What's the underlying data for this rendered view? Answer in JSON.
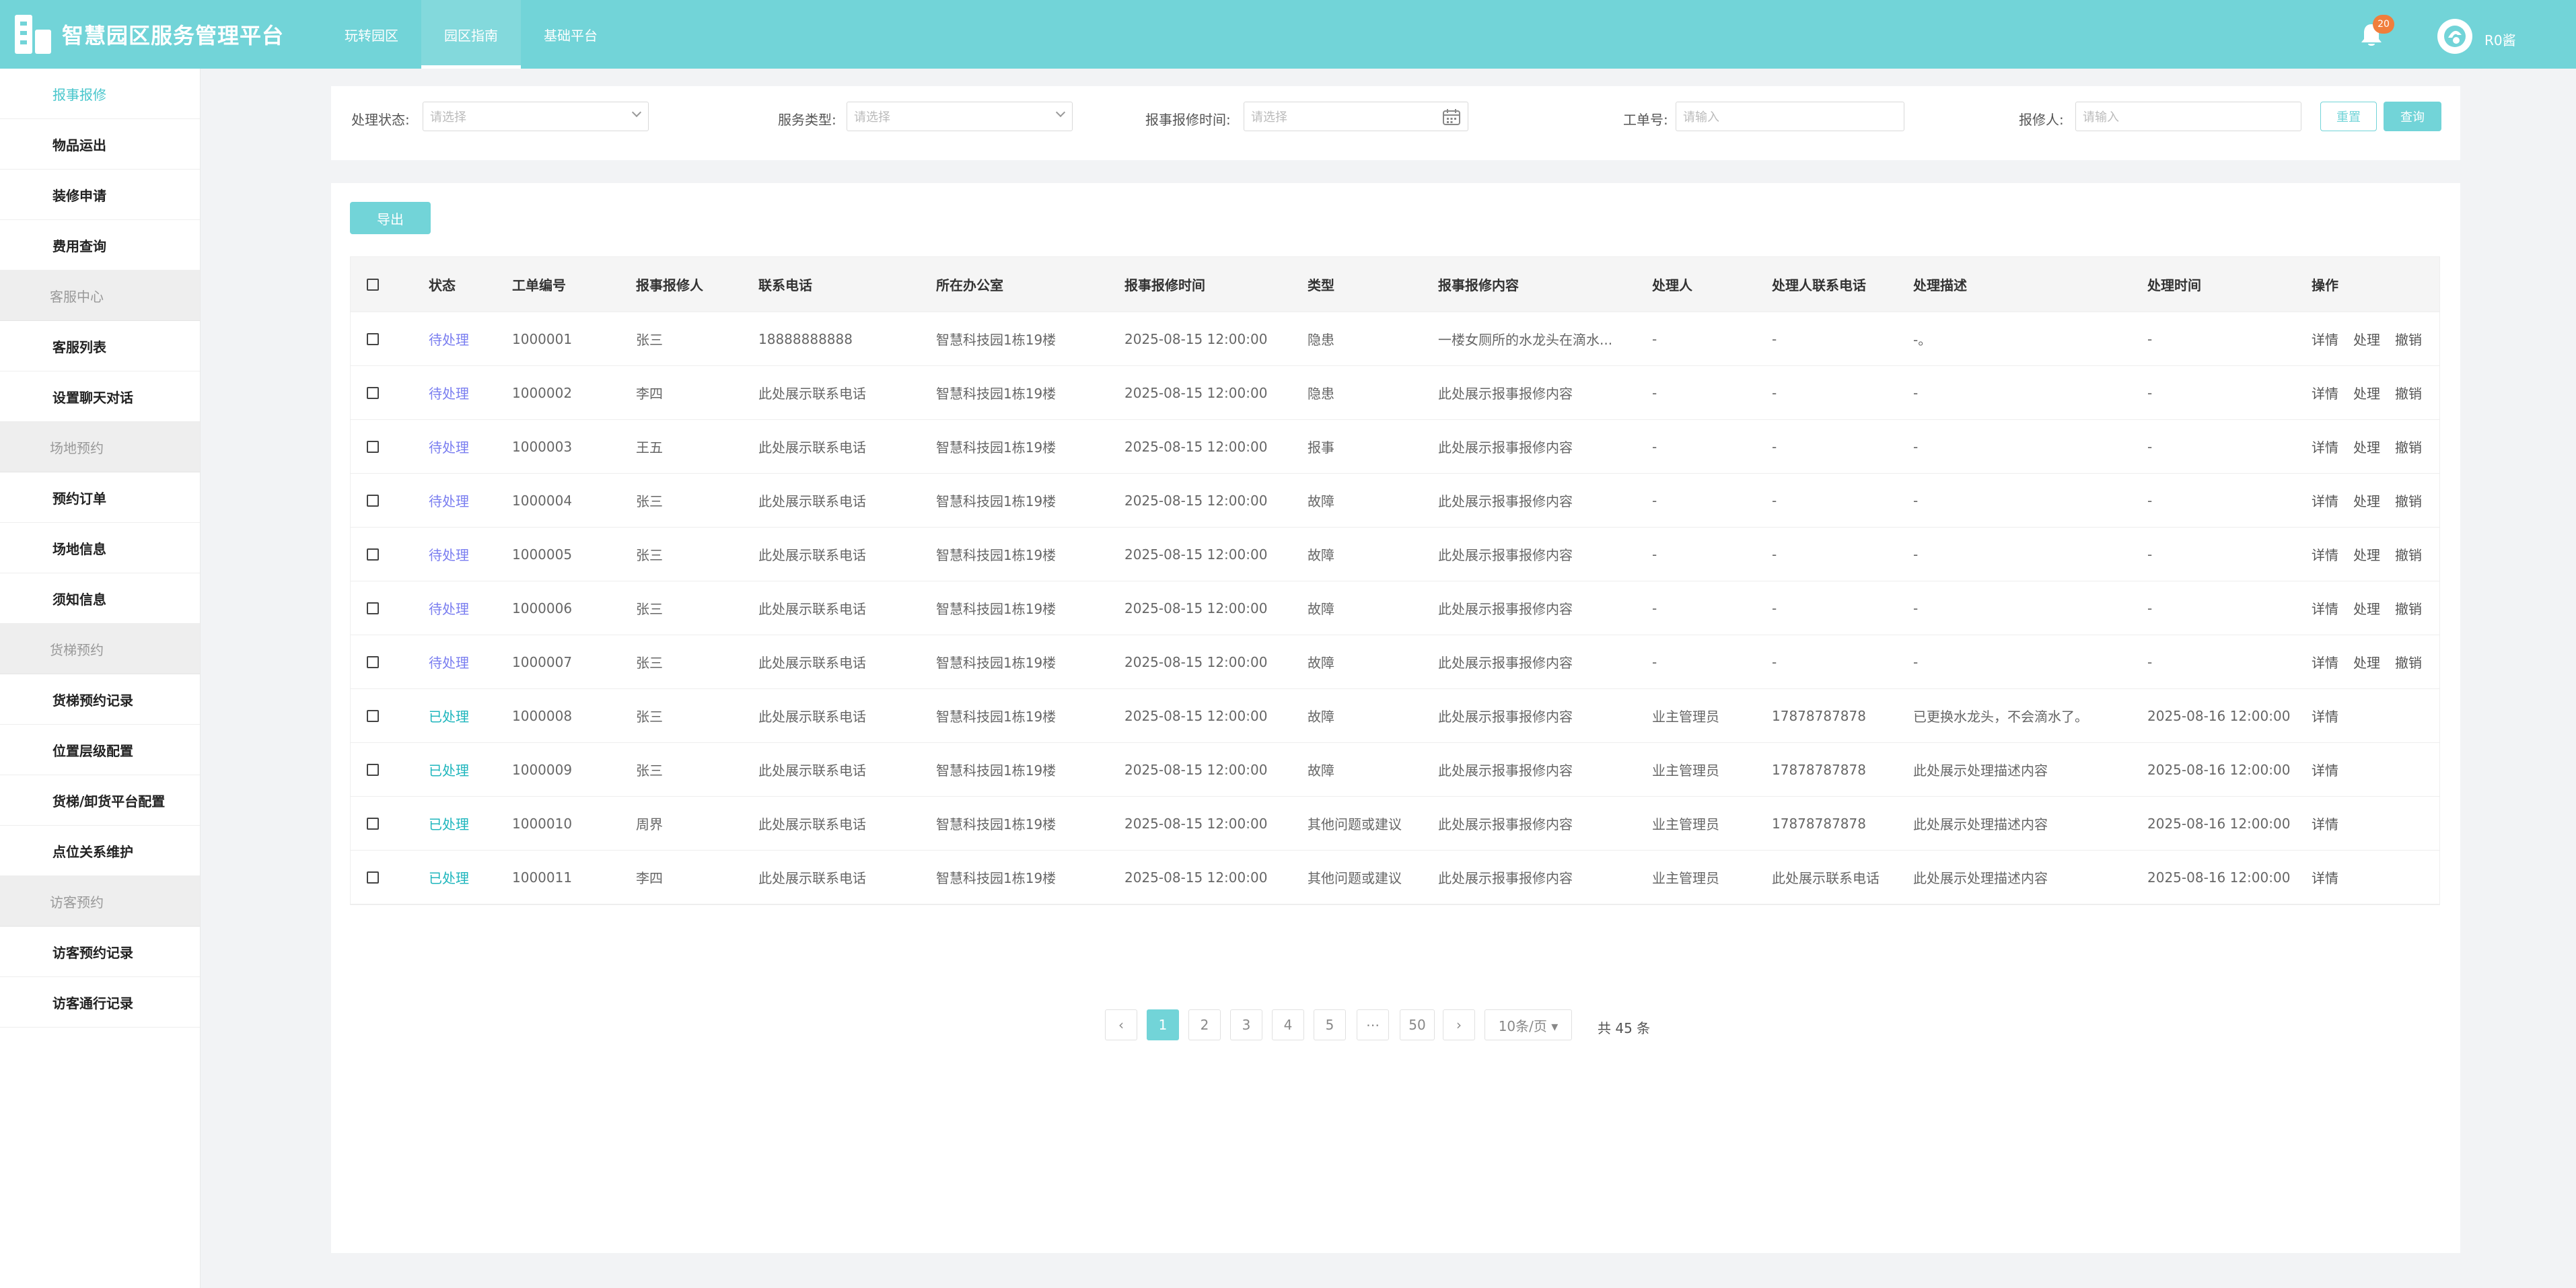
{
  "app": {
    "title": "智慧园区服务管理平台",
    "nav": [
      "玩转园区",
      "园区指南",
      "基础平台"
    ],
    "active_nav_index": 1,
    "notification_count": "20",
    "username": "R0酱"
  },
  "colors": {
    "accent": "#72d4d8",
    "pending": "#7a7ef0",
    "done": "#1fb6bd",
    "badge": "#f07e3c"
  },
  "sidebar": {
    "items": [
      {
        "type": "item",
        "label": "报事报修",
        "active": true
      },
      {
        "type": "item",
        "label": "物品运出"
      },
      {
        "type": "item",
        "label": "装修申请"
      },
      {
        "type": "item",
        "label": "费用查询"
      },
      {
        "type": "group",
        "label": "客服中心"
      },
      {
        "type": "item",
        "label": "客服列表"
      },
      {
        "type": "item",
        "label": "设置聊天对话"
      },
      {
        "type": "group",
        "label": "场地预约"
      },
      {
        "type": "item",
        "label": "预约订单"
      },
      {
        "type": "item",
        "label": "场地信息"
      },
      {
        "type": "item",
        "label": "须知信息"
      },
      {
        "type": "group",
        "label": "货梯预约"
      },
      {
        "type": "item",
        "label": "货梯预约记录"
      },
      {
        "type": "item",
        "label": "位置层级配置"
      },
      {
        "type": "item",
        "label": "货梯/卸货平台配置"
      },
      {
        "type": "item",
        "label": "点位关系维护"
      },
      {
        "type": "group",
        "label": "访客预约"
      },
      {
        "type": "item",
        "label": "访客预约记录"
      },
      {
        "type": "item",
        "label": "访客通行记录"
      }
    ]
  },
  "filters": {
    "status_label": "处理状态:",
    "status_placeholder": "请选择",
    "service_label": "服务类型:",
    "service_placeholder": "请选择",
    "time_label": "报事报修时间:",
    "time_placeholder": "请选择",
    "order_label": "工单号:",
    "order_placeholder": "请输入",
    "reporter_label": "报修人:",
    "reporter_placeholder": "请输入",
    "reset": "重置",
    "query": "查询"
  },
  "export_label": "导出",
  "table": {
    "headers": [
      "状态",
      "工单编号",
      "报事报修人",
      "联系电话",
      "所在办公室",
      "报事报修时间",
      "类型",
      "报事报修内容",
      "处理人",
      "处理人联系电话",
      "处理描述",
      "处理时间",
      "操作"
    ],
    "rows": [
      {
        "status": "待处理",
        "done": false,
        "id": "1000001",
        "reporter": "张三",
        "phone": "18888888888",
        "office": "智慧科技园1栋19楼",
        "time": "2025-08-15 12:00:00",
        "type": "隐患",
        "content": "一楼女厕所的水龙头在滴水...",
        "handler": "-",
        "handler_phone": "-",
        "desc": "-。",
        "handle_time": "-",
        "ops": [
          "详情",
          "处理",
          "撤销"
        ]
      },
      {
        "status": "待处理",
        "done": false,
        "id": "1000002",
        "reporter": "李四",
        "phone": "此处展示联系电话",
        "office": "智慧科技园1栋19楼",
        "time": "2025-08-15 12:00:00",
        "type": "隐患",
        "content": "此处展示报事报修内容",
        "handler": "-",
        "handler_phone": "-",
        "desc": "-",
        "handle_time": "-",
        "ops": [
          "详情",
          "处理",
          "撤销"
        ]
      },
      {
        "status": "待处理",
        "done": false,
        "id": "1000003",
        "reporter": "王五",
        "phone": "此处展示联系电话",
        "office": "智慧科技园1栋19楼",
        "time": "2025-08-15 12:00:00",
        "type": "报事",
        "content": "此处展示报事报修内容",
        "handler": "-",
        "handler_phone": "-",
        "desc": "-",
        "handle_time": "-",
        "ops": [
          "详情",
          "处理",
          "撤销"
        ]
      },
      {
        "status": "待处理",
        "done": false,
        "id": "1000004",
        "reporter": "张三",
        "phone": "此处展示联系电话",
        "office": "智慧科技园1栋19楼",
        "time": "2025-08-15 12:00:00",
        "type": "故障",
        "content": "此处展示报事报修内容",
        "handler": "-",
        "handler_phone": "-",
        "desc": "-",
        "handle_time": "-",
        "ops": [
          "详情",
          "处理",
          "撤销"
        ]
      },
      {
        "status": "待处理",
        "done": false,
        "id": "1000005",
        "reporter": "张三",
        "phone": "此处展示联系电话",
        "office": "智慧科技园1栋19楼",
        "time": "2025-08-15 12:00:00",
        "type": "故障",
        "content": "此处展示报事报修内容",
        "handler": "-",
        "handler_phone": "-",
        "desc": "-",
        "handle_time": "-",
        "ops": [
          "详情",
          "处理",
          "撤销"
        ]
      },
      {
        "status": "待处理",
        "done": false,
        "id": "1000006",
        "reporter": "张三",
        "phone": "此处展示联系电话",
        "office": "智慧科技园1栋19楼",
        "time": "2025-08-15 12:00:00",
        "type": "故障",
        "content": "此处展示报事报修内容",
        "handler": "-",
        "handler_phone": "-",
        "desc": "-",
        "handle_time": "-",
        "ops": [
          "详情",
          "处理",
          "撤销"
        ]
      },
      {
        "status": "待处理",
        "done": false,
        "id": "1000007",
        "reporter": "张三",
        "phone": "此处展示联系电话",
        "office": "智慧科技园1栋19楼",
        "time": "2025-08-15 12:00:00",
        "type": "故障",
        "content": "此处展示报事报修内容",
        "handler": "-",
        "handler_phone": "-",
        "desc": "-",
        "handle_time": "-",
        "ops": [
          "详情",
          "处理",
          "撤销"
        ]
      },
      {
        "status": "已处理",
        "done": true,
        "id": "1000008",
        "reporter": "张三",
        "phone": "此处展示联系电话",
        "office": "智慧科技园1栋19楼",
        "time": "2025-08-15 12:00:00",
        "type": "故障",
        "content": "此处展示报事报修内容",
        "handler": "业主管理员",
        "handler_phone": "17878787878",
        "desc": "已更换水龙头，不会滴水了。",
        "handle_time": "2025-08-16 12:00:00",
        "ops": [
          "详情"
        ]
      },
      {
        "status": "已处理",
        "done": true,
        "id": "1000009",
        "reporter": "张三",
        "phone": "此处展示联系电话",
        "office": "智慧科技园1栋19楼",
        "time": "2025-08-15 12:00:00",
        "type": "故障",
        "content": "此处展示报事报修内容",
        "handler": "业主管理员",
        "handler_phone": "17878787878",
        "desc": "此处展示处理描述内容",
        "handle_time": "2025-08-16 12:00:00",
        "ops": [
          "详情"
        ]
      },
      {
        "status": "已处理",
        "done": true,
        "id": "1000010",
        "reporter": "周界",
        "phone": "此处展示联系电话",
        "office": "智慧科技园1栋19楼",
        "time": "2025-08-15 12:00:00",
        "type": "其他问题或建议",
        "content": "此处展示报事报修内容",
        "handler": "业主管理员",
        "handler_phone": "17878787878",
        "desc": "此处展示处理描述内容",
        "handle_time": "2025-08-16 12:00:00",
        "ops": [
          "详情"
        ]
      },
      {
        "status": "已处理",
        "done": true,
        "id": "1000011",
        "reporter": "李四",
        "phone": "此处展示联系电话",
        "office": "智慧科技园1栋19楼",
        "time": "2025-08-15 12:00:00",
        "type": "其他问题或建议",
        "content": "此处展示报事报修内容",
        "handler": "业主管理员",
        "handler_phone": "此处展示联系电话",
        "desc": "此处展示处理描述内容",
        "handle_time": "2025-08-16 12:00:00",
        "ops": [
          "详情"
        ]
      }
    ]
  },
  "pagination": {
    "prev": "‹",
    "pages": [
      "1",
      "2",
      "3",
      "4",
      "5"
    ],
    "current": "1",
    "ellipsis": "⋯",
    "last": "50",
    "next": "›",
    "page_size": "10条/页 ▾",
    "total": "共 45 条"
  }
}
